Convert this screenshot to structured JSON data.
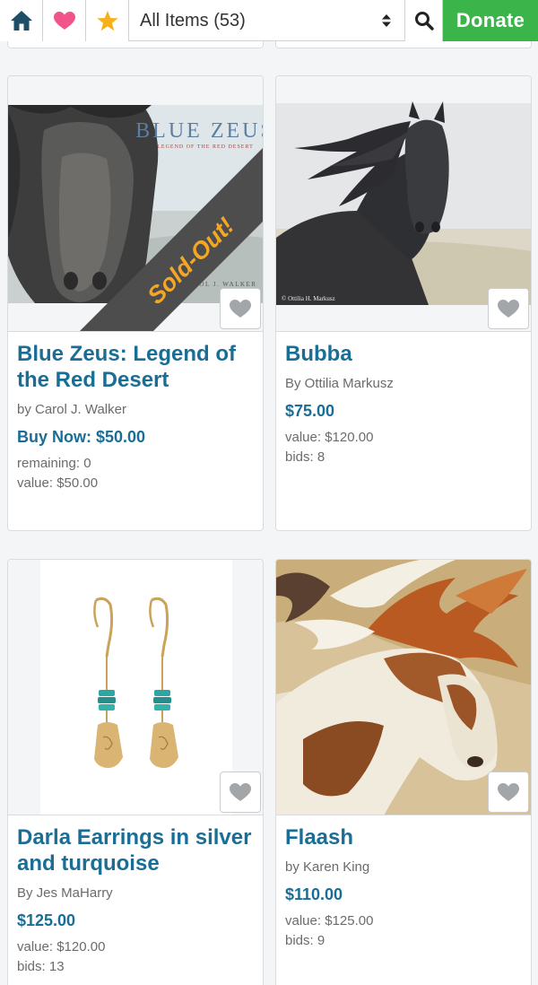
{
  "toolbar": {
    "home_icon": "home-icon",
    "favorites_icon": "heart-icon",
    "starred_icon": "star-icon",
    "filter_label": "All Items (53)",
    "search_icon": "search-icon",
    "donate_label": "Donate"
  },
  "colors": {
    "accent": "#1a6e96",
    "donate": "#3bb54a",
    "heart": "#f0548a",
    "star": "#f6b21b",
    "sold_banner": "#f5a623"
  },
  "items": [
    {
      "title": "Blue Zeus: Legend of the Red Desert",
      "by": "by Carol J. Walker",
      "price": "Buy Now: $50.00",
      "meta1": "remaining: 0",
      "meta2": "value: $50.00",
      "cover_title": "BLUE ZEUS",
      "cover_subtitle": "LEGEND OF THE RED DESERT",
      "cover_author": "CAROL J. WALKER",
      "banner": "Sold-Out!"
    },
    {
      "title": "Bubba",
      "by": "By Ottilia Markusz",
      "price": "$75.00",
      "meta1": "value: $120.00",
      "meta2": "bids: 8",
      "photo_credit": "© Ottilia H. Markusz"
    },
    {
      "title": "Darla Earrings in silver and turquoise",
      "by": "By Jes MaHarry",
      "price": "$125.00",
      "meta1": "value: $120.00",
      "meta2": "bids: 13"
    },
    {
      "title": "Flaash",
      "by": "by Karen King",
      "price": "$110.00",
      "meta1": "value: $125.00",
      "meta2": "bids: 9"
    }
  ]
}
